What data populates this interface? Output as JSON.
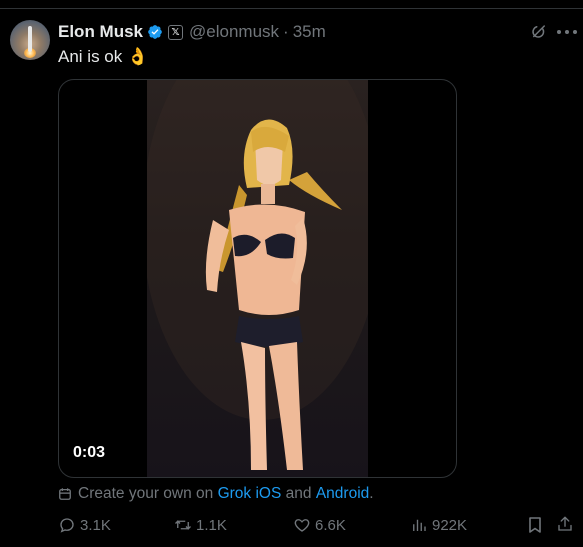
{
  "author": {
    "name": "Elon Musk",
    "handle": "@elonmusk",
    "separator": "·",
    "time": "35m",
    "verified_color": "#1d9bf0"
  },
  "tweet": {
    "text": "Ani is ok 👌"
  },
  "media": {
    "timestamp": "0:03"
  },
  "grok_promo": {
    "prefix": "Create your own on",
    "link1": "Grok iOS",
    "middle": "and",
    "link2": "Android",
    "suffix": "."
  },
  "actions": {
    "replies": "3.1K",
    "reposts": "1.1K",
    "likes": "6.6K",
    "views": "922K"
  },
  "colors": {
    "background": "#000000",
    "text": "#e7e9ea",
    "muted": "#71767b",
    "accent": "#1d9bf0"
  }
}
